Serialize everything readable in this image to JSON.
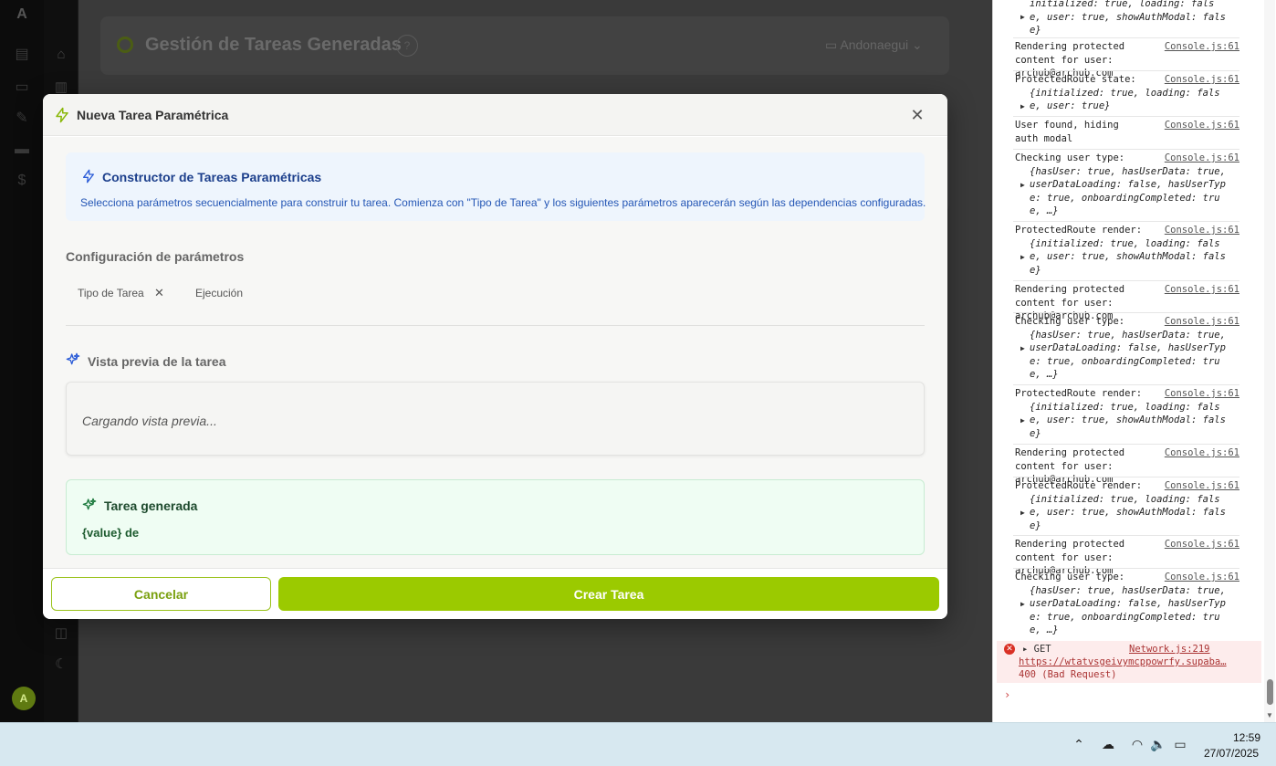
{
  "app": {
    "logo_letter": "A",
    "page_title": "Gestión de Tareas Generadas",
    "help_glyph": "?",
    "project_selector": "Andonaegui",
    "avatar_initial": "A"
  },
  "modal": {
    "title": "Nueva Tarea Paramétrica",
    "close_glyph": "✕",
    "info": {
      "title": "Constructor de Tareas Paramétricas",
      "text": "Selecciona parámetros secuencialmente para construir tu tarea. Comienza con \"Tipo de Tarea\" y los siguientes parámetros aparecerán según las dependencias configuradas."
    },
    "config": {
      "title": "Configuración de parámetros",
      "chips": [
        {
          "label": "Tipo de Tarea",
          "remove_glyph": "✕"
        },
        {
          "label": "Ejecución"
        }
      ]
    },
    "preview": {
      "title": "Vista previa de la tarea",
      "loading_text": "Cargando vista previa..."
    },
    "generated": {
      "title": "Tarea generada",
      "text": "{value} de"
    },
    "footer": {
      "cancel_label": "Cancelar",
      "create_label": "Crear Tarea"
    },
    "colors": {
      "accent": "#9bca00",
      "info_bg": "#eef5fd",
      "success_bg": "#effdf3"
    }
  },
  "console": {
    "source_label": "Console.js:61",
    "entries": [
      {
        "msg": "",
        "obj": "initialized: true, loading: fals\ne, user: true, showAuthModal: fals\ne}"
      },
      {
        "msg": "Rendering protected\ncontent for user: archub@archub.com",
        "obj": ""
      },
      {
        "msg": "ProtectedRoute state:",
        "obj": "{initialized: true, loading: fals\ne, user: true}"
      },
      {
        "msg": "User found, hiding\nauth modal",
        "obj": ""
      },
      {
        "msg": "Checking user type:",
        "obj": "{hasUser: true, hasUserData: true,\nuserDataLoading: false, hasUserTyp\ne: true, onboardingCompleted: tru\ne, …}"
      },
      {
        "msg": "ProtectedRoute render:",
        "obj": "{initialized: true, loading: fals\ne, user: true, showAuthModal: fals\ne}"
      },
      {
        "msg": "Rendering protected\ncontent for user: archub@archub.com",
        "obj": ""
      },
      {
        "msg": "Checking user type:",
        "obj": "{hasUser: true, hasUserData: true,\nuserDataLoading: false, hasUserTyp\ne: true, onboardingCompleted: tru\ne, …}"
      },
      {
        "msg": "ProtectedRoute render:",
        "obj": "{initialized: true, loading: fals\ne, user: true, showAuthModal: fals\ne}"
      },
      {
        "msg": "Rendering protected\ncontent for user: archub@archub.com",
        "obj": ""
      },
      {
        "msg": "ProtectedRoute render:",
        "obj": "{initialized: true, loading: fals\ne, user: true, showAuthModal: fals\ne}"
      },
      {
        "msg": "Rendering protected\ncontent for user: archub@archub.com",
        "obj": ""
      },
      {
        "msg": "Checking user type:",
        "obj": "{hasUser: true, hasUserData: true,\nuserDataLoading: false, hasUserTyp\ne: true, onboardingCompleted: tru\ne, …}"
      }
    ],
    "error": {
      "method": "GET",
      "source": "Network.js:219",
      "url": "https://wtatvsgeivymcppowrfy.supaba…",
      "status": "400 (Bad Request)"
    },
    "prompt": "›"
  },
  "taskbar": {
    "time": "12:59",
    "date": "27/07/2025"
  }
}
